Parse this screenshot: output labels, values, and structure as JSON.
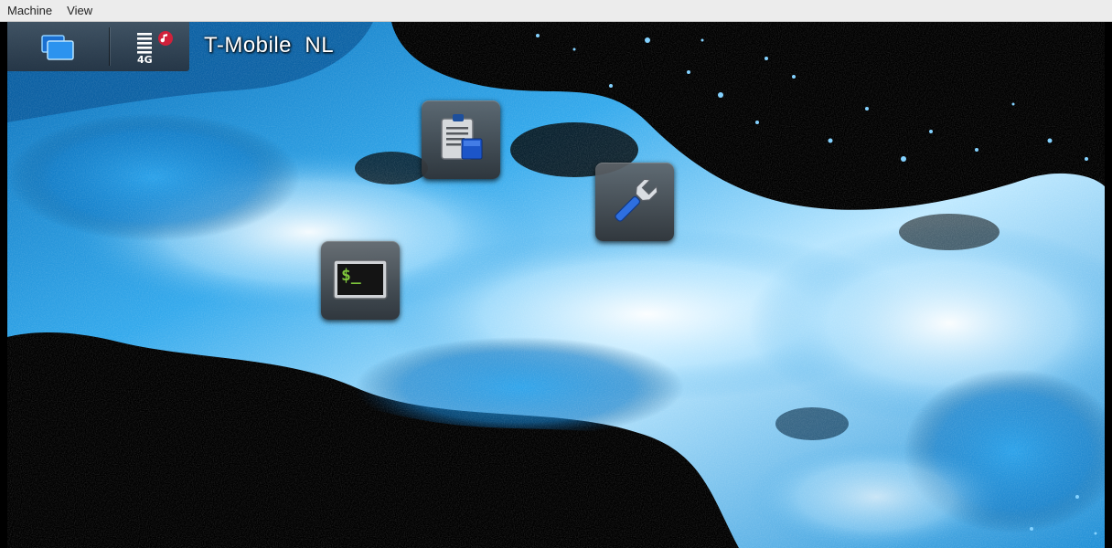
{
  "menubar": {
    "items": [
      {
        "label": "Machine"
      },
      {
        "label": "View"
      }
    ]
  },
  "statusbar": {
    "task_switcher_icon": "task-switcher-icon",
    "signal": {
      "network_type": "4G",
      "icon": "signal-strength-icon",
      "extra_icon": "music-note-icon"
    },
    "operator_name": "T-Mobile  NL"
  },
  "desktop": {
    "wallpaper": "water-splash",
    "accent_color": "#1e9be0",
    "icons": [
      {
        "name": "clipboard-app-icon"
      },
      {
        "name": "settings-wrench-app-icon"
      },
      {
        "name": "terminal-app-icon",
        "prompt_text": "$_"
      }
    ]
  }
}
